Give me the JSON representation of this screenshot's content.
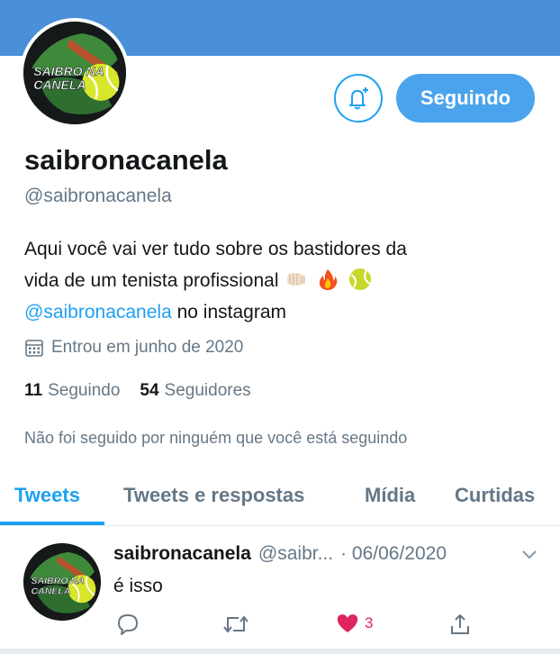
{
  "profile": {
    "avatar_logo_text": "SAIBRO NA CANELA",
    "follow_button_label": "Seguindo",
    "display_name": "saibronacanela",
    "handle": "@saibronacanela",
    "bio_line1": "Aqui você vai ver tudo sobre os bastidores da",
    "bio_line2": "vida de um tenista profissional",
    "bio_emojis": [
      "fist-bump-icon",
      "fire-icon",
      "tennis-ball-icon"
    ],
    "bio_link": "@saibronacanela",
    "bio_suffix": " no instagram",
    "joined": "Entrou em junho de 2020",
    "following_count": "11",
    "following_label": "Seguindo",
    "followers_count": "54",
    "followers_label": "Seguidores",
    "followed_by": "Não foi seguido por ninguém que você está seguindo"
  },
  "tabs": [
    {
      "label": "Tweets",
      "active": true
    },
    {
      "label": "Tweets e respostas",
      "active": false
    },
    {
      "label": "Mídia",
      "active": false
    },
    {
      "label": "Curtidas",
      "active": false
    }
  ],
  "tweet": {
    "name": "saibronacanela",
    "handle": "@saibr...",
    "date": "· 06/06/2020",
    "text": "é isso",
    "like_count": "3"
  },
  "colors": {
    "accent": "#1da1f2",
    "banner": "#4a90d9",
    "like": "#e0245e",
    "muted": "#657786"
  }
}
